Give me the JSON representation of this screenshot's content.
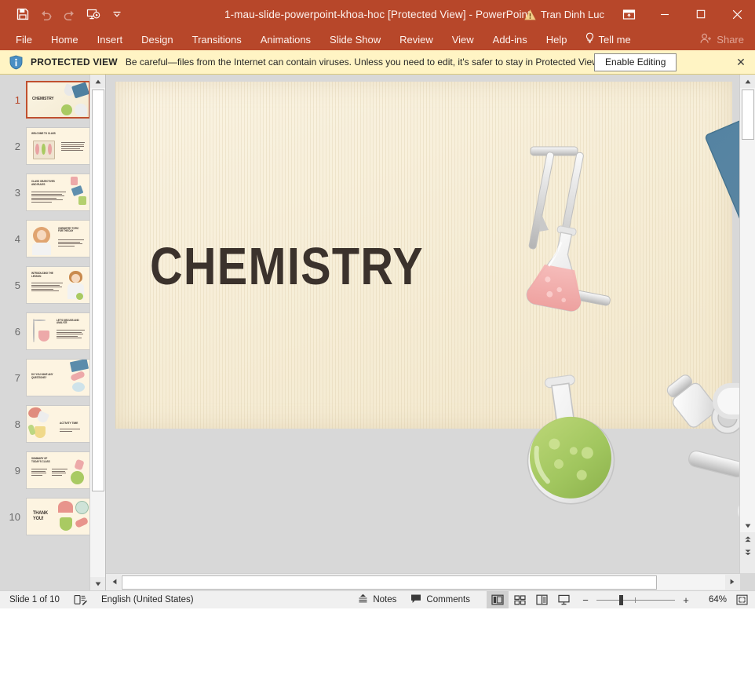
{
  "window": {
    "title": "1-mau-slide-powerpoint-khoa-hoc [Protected View]  -  PowerPoint",
    "user_name": "Tran Dinh Luc",
    "accent_color": "#b7472a",
    "minimize_label": "—",
    "maximize_label": "☐",
    "close_label": "✕"
  },
  "quick_access": [
    {
      "name": "save-button",
      "label": "Save"
    },
    {
      "name": "undo-button",
      "label": "Undo"
    },
    {
      "name": "redo-button",
      "label": "Redo"
    },
    {
      "name": "start-from-beginning-button",
      "label": "Start From Beginning"
    },
    {
      "name": "customize-quick-access-toolbar-button",
      "label": "Customize Quick Access Toolbar"
    }
  ],
  "ribbon": {
    "tabs": [
      {
        "label": "File"
      },
      {
        "label": "Home"
      },
      {
        "label": "Insert"
      },
      {
        "label": "Design"
      },
      {
        "label": "Transitions"
      },
      {
        "label": "Animations"
      },
      {
        "label": "Slide Show"
      },
      {
        "label": "Review"
      },
      {
        "label": "View"
      },
      {
        "label": "Add-ins"
      },
      {
        "label": "Help"
      }
    ],
    "tell_me": "Tell me",
    "share": "Share",
    "ribbon_display_options": "Ribbon Display Options"
  },
  "protected_view": {
    "label": "PROTECTED VIEW",
    "message": "Be careful—files from the Internet can contain viruses. Unless you need to edit, it's safer to stay in Protected View.",
    "enable_button": "Enable Editing",
    "close": "✕",
    "background": "#fff4c4"
  },
  "thumbnails": [
    {
      "number": "1",
      "title": "CHEMISTRY",
      "selected": true
    },
    {
      "number": "2",
      "title": "WELCOME TO CLASS",
      "selected": false
    },
    {
      "number": "3",
      "title": "CLASS OBJECTIVES AND RULES",
      "selected": false
    },
    {
      "number": "4",
      "title": "CHEMISTRY TOPIC FOR THE DAY",
      "selected": false
    },
    {
      "number": "5",
      "title": "INTRODUCING THE LESSON",
      "selected": false
    },
    {
      "number": "6",
      "title": "LET'S DISCUSS AND ANALYZE",
      "selected": false
    },
    {
      "number": "7",
      "title": "DO YOU HAVE ANY QUESTIONS?",
      "selected": false
    },
    {
      "number": "8",
      "title": "ACTIVITY TIME",
      "selected": false
    },
    {
      "number": "9",
      "title": "SUMMARY OF TODAY'S CLASS",
      "selected": false
    },
    {
      "number": "10",
      "title": "THANK YOU!",
      "selected": false
    }
  ],
  "slide": {
    "title": "CHEMISTRY",
    "background_color": "#f6edd6",
    "title_color": "#3b322c",
    "artwork": [
      {
        "name": "erlenmeyer-flask-with-stand",
        "liquid_color": "#f0a3a3"
      },
      {
        "name": "blue-spiral-notebook",
        "cover_color": "#4d7f9e"
      },
      {
        "name": "round-bottom-flask-green",
        "liquid_color": "#9cc martial"
      },
      {
        "name": "microscope",
        "color": "#f2f2f2"
      }
    ]
  },
  "status_bar": {
    "slide_indicator": "Slide 1 of 10",
    "language": "English (United States)",
    "accessibility_label": "Accessibility Checker",
    "notes": "Notes",
    "comments": "Comments",
    "views": [
      {
        "name": "normal-view-button",
        "label": "Normal",
        "active": true
      },
      {
        "name": "slide-sorter-view-button",
        "label": "Slide Sorter",
        "active": false
      },
      {
        "name": "reading-view-button",
        "label": "Reading View",
        "active": false
      },
      {
        "name": "slide-show-button",
        "label": "Slide Show",
        "active": false
      }
    ],
    "zoom_out": "−",
    "zoom_in": "+",
    "zoom_level": "64%",
    "fit_label": "Fit slide to current window"
  }
}
